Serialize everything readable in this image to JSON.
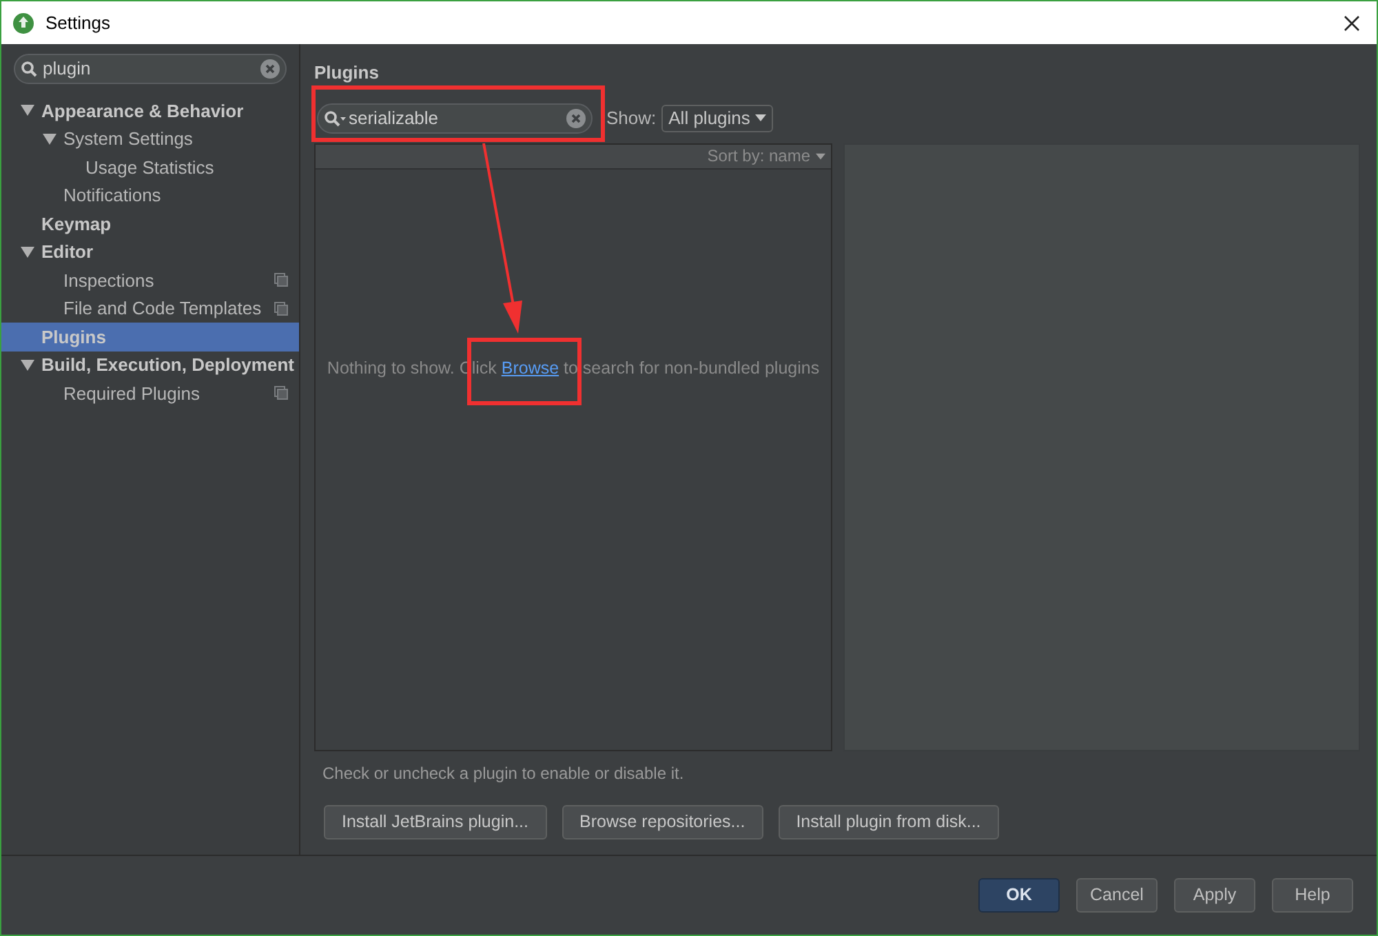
{
  "window": {
    "title": "Settings"
  },
  "sidebar": {
    "search": {
      "value": "plugin"
    },
    "tree": [
      {
        "label": "Appearance & Behavior",
        "expanded": true,
        "selected": false,
        "children": [
          {
            "label": "System Settings",
            "expanded": true,
            "selected": false,
            "children": [
              {
                "label": "Usage Statistics",
                "selected": false,
                "project_level": false
              }
            ]
          },
          {
            "label": "Notifications",
            "selected": false,
            "project_level": false
          }
        ]
      },
      {
        "label": "Keymap",
        "selected": false,
        "project_level": false
      },
      {
        "label": "Editor",
        "expanded": true,
        "selected": false,
        "children": [
          {
            "label": "Inspections",
            "selected": false,
            "project_level": true
          },
          {
            "label": "File and Code Templates",
            "selected": false,
            "project_level": true
          }
        ]
      },
      {
        "label": "Plugins",
        "selected": true,
        "project_level": false
      },
      {
        "label": "Build, Execution, Deployment",
        "expanded": true,
        "selected": false,
        "children": [
          {
            "label": "Required Plugins",
            "selected": false,
            "project_level": true
          }
        ]
      }
    ]
  },
  "page": {
    "title": "Plugins",
    "search": {
      "value": "serializable"
    },
    "show_label": "Show:",
    "show_value": "All plugins",
    "sort": "Sort by: name",
    "empty_before": "Nothing to show. Click ",
    "empty_link": "Browse",
    "empty_after": " to search for non-bundled plugins",
    "hint": "Check or uncheck a plugin to enable or disable it.",
    "buttons": [
      "Install JetBrains plugin...",
      "Browse repositories...",
      "Install plugin from disk..."
    ]
  },
  "footer": {
    "buttons": [
      {
        "label": "OK",
        "default": true
      },
      {
        "label": "Cancel",
        "default": false
      },
      {
        "label": "Apply",
        "default": false
      },
      {
        "label": "Help",
        "default": false
      }
    ]
  }
}
